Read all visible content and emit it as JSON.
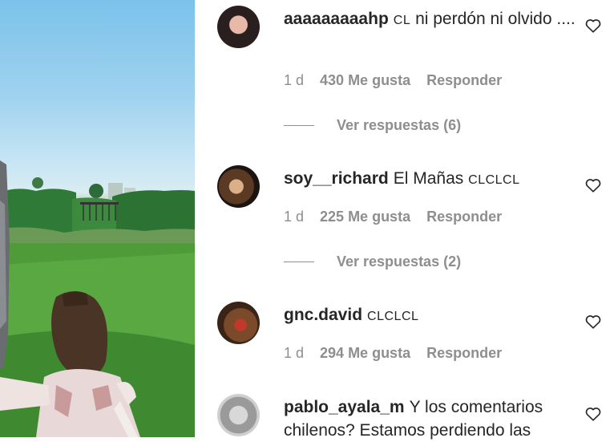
{
  "photo": {
    "alt_colors": {
      "sky": "#9fd2ef",
      "grass": "#4f9b3a"
    }
  },
  "comments": [
    {
      "username": "aaaaaaaaahp",
      "tag": "CL",
      "text": "ni perdón ni olvido ....",
      "time": "1 d",
      "likes": "430 Me gusta",
      "reply_label": "Responder",
      "view_replies": "Ver respuestas (6)"
    },
    {
      "username": "soy__richard",
      "tag": "",
      "text": "El Mañas",
      "tag_after": "CLCLCL",
      "time": "1 d",
      "likes": "225 Me gusta",
      "reply_label": "Responder",
      "view_replies": "Ver respuestas (2)"
    },
    {
      "username": "gnc.david",
      "tag": "CLCLCL",
      "text": "",
      "time": "1 d",
      "likes": "294 Me gusta",
      "reply_label": "Responder"
    },
    {
      "username": "pablo_ayala_m",
      "tag": "",
      "text": "Y los comentarios chilenos? Estamos perdiendo las"
    }
  ],
  "icons": {
    "like": "heart-outline-icon"
  },
  "colors": {
    "text": "#262626",
    "secondary": "#8e8e8e"
  }
}
